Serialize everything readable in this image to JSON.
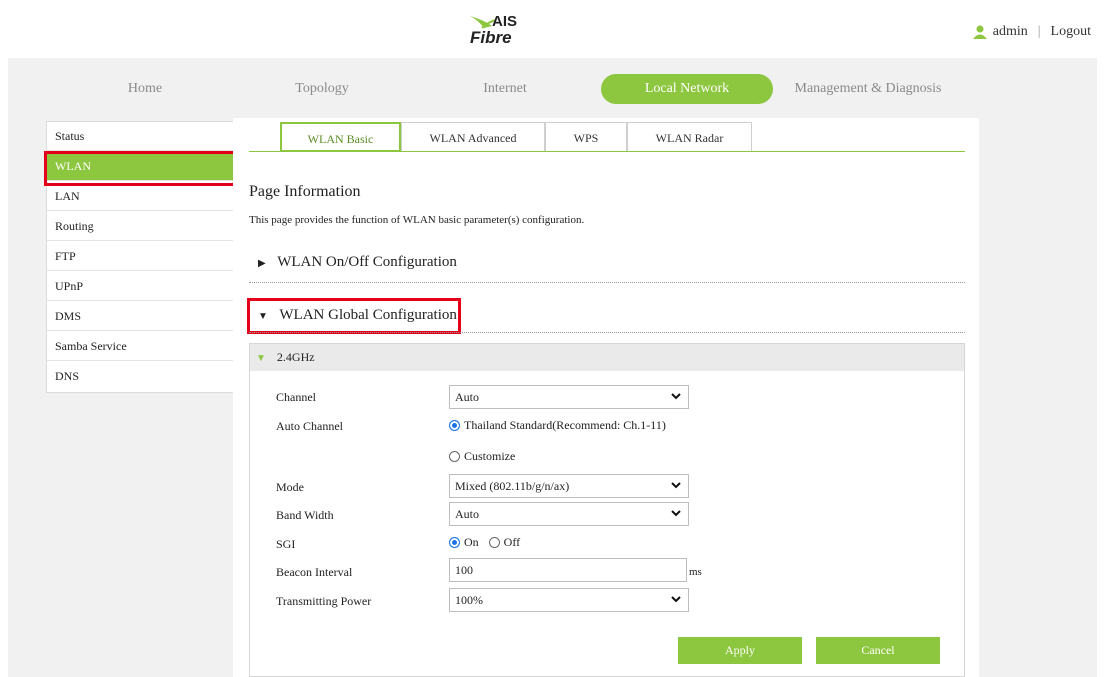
{
  "header": {
    "logo_top": "AIS",
    "logo_bottom": "Fibre",
    "user": "admin",
    "separator": "|",
    "logout": "Logout"
  },
  "nav": {
    "items": [
      "Home",
      "Topology",
      "Internet",
      "Local Network",
      "Management & Diagnosis"
    ],
    "active": "Local Network"
  },
  "sidebar": {
    "items": [
      "Status",
      "WLAN",
      "LAN",
      "Routing",
      "FTP",
      "UPnP",
      "DMS",
      "Samba Service",
      "DNS"
    ],
    "active": "WLAN"
  },
  "tabs": {
    "items": [
      "WLAN Basic",
      "WLAN Advanced",
      "WPS",
      "WLAN Radar"
    ],
    "active": "WLAN Basic"
  },
  "page": {
    "title": "Page Information",
    "description": "This page provides the function of WLAN basic parameter(s) configuration."
  },
  "sections": {
    "onoff": "WLAN On/Off Configuration",
    "global": "WLAN Global Configuration"
  },
  "band": {
    "label": "2.4GHz"
  },
  "form": {
    "channel_label": "Channel",
    "channel_value": "Auto",
    "auto_channel_label": "Auto Channel",
    "auto_channel_option1": "Thailand Standard(Recommend: Ch.1-11)",
    "auto_channel_option2": "Customize",
    "mode_label": "Mode",
    "mode_value": "Mixed (802.11b/g/n/ax)",
    "bandwidth_label": "Band Width",
    "bandwidth_value": "Auto",
    "sgi_label": "SGI",
    "sgi_on": "On",
    "sgi_off": "Off",
    "beacon_label": "Beacon Interval",
    "beacon_value": "100",
    "beacon_unit": "ms",
    "power_label": "Transmitting Power",
    "power_value": "100%"
  },
  "buttons": {
    "apply": "Apply",
    "cancel": "Cancel"
  },
  "colors": {
    "accent": "#8dc63f",
    "highlight": "#e4001b",
    "radio": "#1a73e8"
  }
}
